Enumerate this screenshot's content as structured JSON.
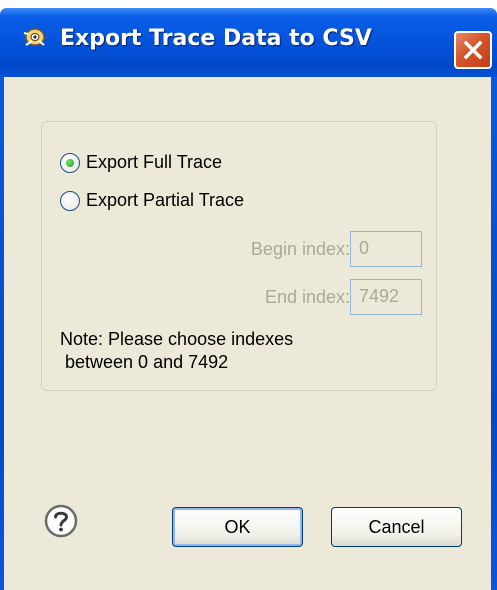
{
  "window": {
    "title": "Export Trace Data to CSV"
  },
  "options": {
    "full_label": "Export Full Trace",
    "partial_label": "Export Partial Trace",
    "selected": "full"
  },
  "fields": {
    "begin_label": "Begin index:",
    "begin_value": "0",
    "end_label": "End index:",
    "end_value": "7492"
  },
  "note": {
    "line1": "Note: Please choose indexes",
    "line2": " between 0 and 7492"
  },
  "buttons": {
    "ok": "OK",
    "cancel": "Cancel"
  },
  "icons": {
    "title": "app-icon",
    "close": "close-icon",
    "help": "help-icon"
  },
  "colors": {
    "titlebar": "#0553db",
    "close": "#d8542a",
    "client": "#ece9d8",
    "disabled_text": "#aca899",
    "field_border": "#93b6d6"
  }
}
